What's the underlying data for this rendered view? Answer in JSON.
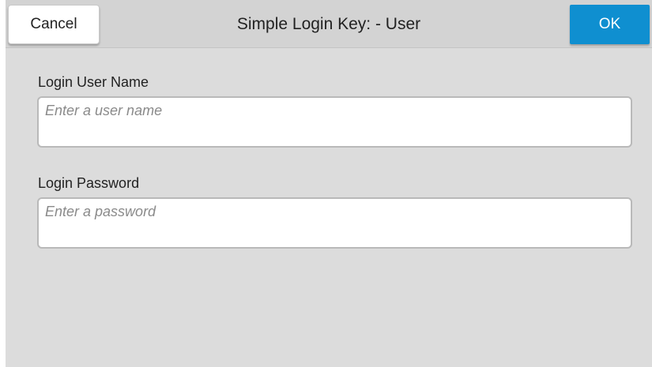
{
  "header": {
    "cancel_label": "Cancel",
    "title": "Simple Login Key: - User",
    "ok_label": "OK"
  },
  "form": {
    "username": {
      "label": "Login User Name",
      "placeholder": "Enter a user name",
      "value": ""
    },
    "password": {
      "label": "Login Password",
      "placeholder": "Enter a password",
      "value": ""
    }
  },
  "colors": {
    "ok_button": "#0f8fd0",
    "background": "#dcdcdc",
    "title_bar": "#d3d3d3"
  }
}
